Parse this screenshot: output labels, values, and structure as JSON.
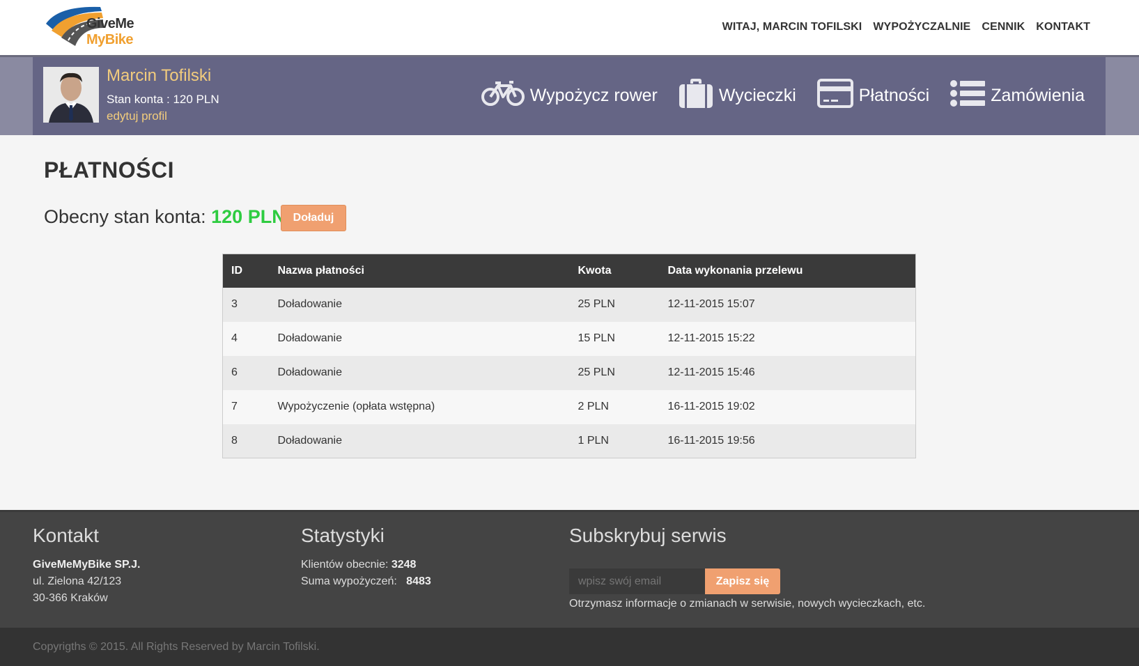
{
  "brand": {
    "line1": "GiveMe",
    "line2": "MyBike",
    "colors": {
      "orange": "#f0a030",
      "blue": "#1a5fa8",
      "green": "#2ecc40"
    }
  },
  "nav": {
    "greeting": "WITAJ, MARCIN TOFILSKI",
    "links": [
      "WYPOŻYCZALNIE",
      "CENNIK",
      "KONTAKT"
    ]
  },
  "profile": {
    "name": "Marcin Tofilski",
    "balance": "Stan konta : 120 PLN",
    "edit": "edytuj profil"
  },
  "actions": [
    {
      "label": "Wypożycz rower",
      "icon": "bicycle-icon"
    },
    {
      "label": "Wycieczki",
      "icon": "suitcase-icon"
    },
    {
      "label": "Płatności",
      "icon": "credit-card-icon"
    },
    {
      "label": "Zamówienia",
      "icon": "list-icon"
    }
  ],
  "page": {
    "title": "PŁATNOŚCI",
    "current_label": "Obecny stan konta: ",
    "current_amount": "120 PLN",
    "topup_button": "Doładuj"
  },
  "table": {
    "headers": [
      "ID",
      "Nazwa płatności",
      "Kwota",
      "Data wykonania przelewu"
    ],
    "rows": [
      [
        "3",
        "Doładowanie",
        "25 PLN",
        "12-11-2015 15:07"
      ],
      [
        "4",
        "Doładowanie",
        "15 PLN",
        "12-11-2015 15:22"
      ],
      [
        "6",
        "Doładowanie",
        "25 PLN",
        "12-11-2015 15:46"
      ],
      [
        "7",
        "Wypożyczenie (opłata wstępna)",
        "2 PLN",
        "16-11-2015 19:02"
      ],
      [
        "8",
        "Doładowanie",
        "1 PLN",
        "16-11-2015 19:56"
      ]
    ]
  },
  "footer": {
    "contact": {
      "title": "Kontakt",
      "company": "GiveMeMyBike SP.J.",
      "street": "ul. Zielona 42/123",
      "city": "30-366 Kraków"
    },
    "stats": {
      "title": "Statystyki",
      "clients_label": "Klientów obecnie: ",
      "clients": "3248",
      "rentals_label": "Suma wypożyczeń: ",
      "rentals": "8483"
    },
    "subscribe": {
      "title": "Subskrybuj serwis",
      "placeholder": "wpisz swój email",
      "button": "Zapisz się",
      "note": "Otrzymasz informacje o zmianach w serwisie, nowych wycieczkach, etc."
    },
    "copyright": "Copyrigths © 2015. All Rights Reserved by Marcin Tofilski."
  }
}
